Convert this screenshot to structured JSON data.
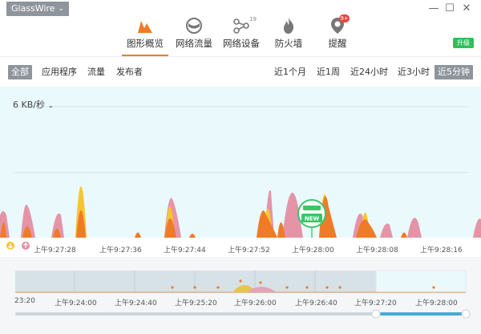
{
  "app": {
    "name": "GlassWire"
  },
  "nav": {
    "tabs": [
      {
        "label": "图形概览",
        "icon": "graph-icon",
        "active": true
      },
      {
        "label": "网络流量",
        "icon": "globe-icon"
      },
      {
        "label": "网络设备",
        "icon": "network-devices-icon",
        "badge": "19"
      },
      {
        "label": "防火墙",
        "icon": "flame-icon"
      },
      {
        "label": "提醒",
        "icon": "alert-icon",
        "badge": "9+"
      }
    ],
    "upgrade_label": "升级"
  },
  "filters": {
    "left": [
      "全部",
      "应用程序",
      "流量",
      "发布者"
    ],
    "right": [
      "近1个月",
      "近1周",
      "近24小时",
      "近3小时",
      "近5分钟"
    ],
    "selected_left": "全部",
    "selected_right": "近5分钟"
  },
  "graph": {
    "unit_label": "6 KB/秒",
    "new_badge": "NEW",
    "time_labels": [
      "上午9:27:28",
      "上午9:27:36",
      "上午9:27:44",
      "上午9:27:52",
      "上午9:28:00",
      "上午9:28:08",
      "上午9:28:16"
    ]
  },
  "overview": {
    "time_labels": [
      "23:20",
      "上午9:24:00",
      "上午9:24:40",
      "上午9:25:20",
      "上午9:26:00",
      "上午9:26:40",
      "上午9:27:20",
      "上午9:28:00"
    ]
  },
  "colors": {
    "accent": "#f07b27",
    "yellow": "#f7c531",
    "pink": "#e58aa0",
    "graph_bg": "#eaf9fc",
    "upgrade": "#2fbf5b"
  }
}
